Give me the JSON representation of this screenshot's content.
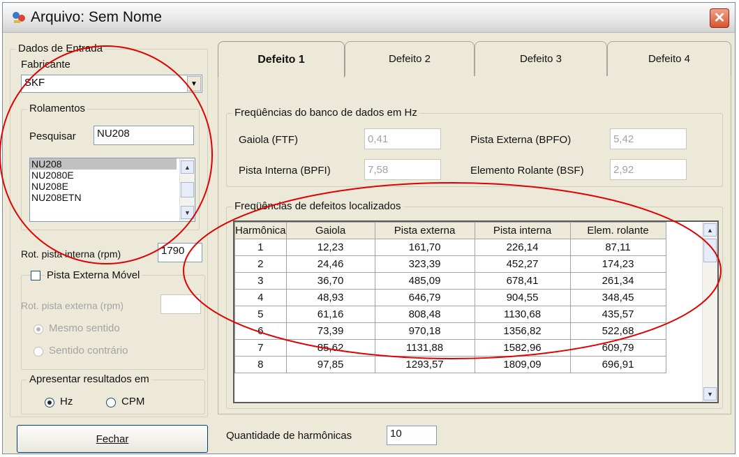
{
  "window": {
    "title": "Arquivo: Sem Nome"
  },
  "entrada": {
    "legend": "Dados de Entrada",
    "fabricante_label": "Fabricante",
    "fabricante_value": "SKF",
    "rolamentos_legend": "Rolamentos",
    "pesquisar_label": "Pesquisar",
    "pesquisar_value": "NU208",
    "list": [
      "NU208",
      "NU2080E",
      "NU208E",
      "NU208ETN"
    ],
    "rot_interna_label": "Rot. pista interna (rpm)",
    "rot_interna_value": "1790",
    "pista_movel_label": "Pista Externa Móvel",
    "rot_externa_label": "Rot. pista externa (rpm)",
    "rot_externa_value": "",
    "mesmo_sentido": "Mesmo sentido",
    "sentido_contrario": "Sentido contrário",
    "resultados_legend": "Apresentar resultados em",
    "hz": "Hz",
    "cpm": "CPM"
  },
  "fechar_label": "Fechar",
  "tabs": [
    "Defeito 1",
    "Defeito 2",
    "Defeito 3",
    "Defeito 4"
  ],
  "banco": {
    "legend": "Freqüências do banco de dados em Hz",
    "gaiola_label": "Gaiola (FTF)",
    "gaiola_value": "0,41",
    "bpfo_label": "Pista Externa (BPFO)",
    "bpfo_value": "5,42",
    "bpfi_label": "Pista Interna (BPFI)",
    "bpfi_value": "7,58",
    "bsf_label": "Elemento Rolante (BSF)",
    "bsf_value": "2,92"
  },
  "localizados": {
    "legend": "Freqüências de defeitos localizados",
    "columns": [
      "Harmônica",
      "Gaiola",
      "Pista externa",
      "Pista interna",
      "Elem. rolante"
    ],
    "rows": [
      [
        "1",
        "12,23",
        "161,70",
        "226,14",
        "87,11"
      ],
      [
        "2",
        "24,46",
        "323,39",
        "452,27",
        "174,23"
      ],
      [
        "3",
        "36,70",
        "485,09",
        "678,41",
        "261,34"
      ],
      [
        "4",
        "48,93",
        "646,79",
        "904,55",
        "348,45"
      ],
      [
        "5",
        "61,16",
        "808,48",
        "1130,68",
        "435,57"
      ],
      [
        "6",
        "73,39",
        "970,18",
        "1356,82",
        "522,68"
      ],
      [
        "7",
        "85,62",
        "1131,88",
        "1582,96",
        "609,79"
      ],
      [
        "8",
        "97,85",
        "1293,57",
        "1809,09",
        "696,91"
      ]
    ]
  },
  "harmonicas_label": "Quantidade de harmônicas",
  "harmonicas_value": "10",
  "colors": {
    "annotation": "#e00000",
    "selection": "#c1c1c1",
    "close": "#d9532f"
  }
}
